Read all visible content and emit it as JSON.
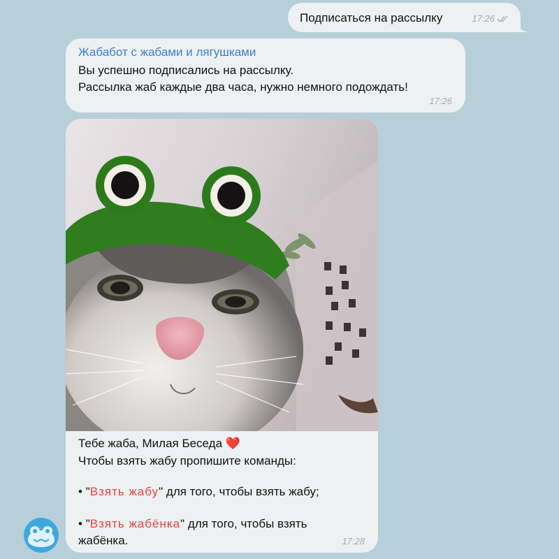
{
  "outgoing": {
    "text": "Подписаться на рассылку",
    "time": "17:26",
    "status_icon": "double-check-icon"
  },
  "message1": {
    "sender": "Жабабот с жабами и лягушками",
    "lines": [
      "Вы успешно подписались на рассылку.",
      "Рассылка жаб каждые два часа, нужно немного подождать!"
    ],
    "time": "17:26"
  },
  "message2": {
    "photo_icon": "cat-in-frog-hat-photo",
    "greeting": "Тебе жаба, Милая Беседа",
    "heart": "❤️",
    "instruction": "Чтобы взять жабу пропишите команды:",
    "bullet": "•",
    "quote": "\"",
    "cmd1": "Взять жабу",
    "cmd1_rest": " для того, чтобы взять жабу;",
    "cmd2": "Взять жабёнка",
    "cmd2_rest": " для того, чтобы взять",
    "cmd2_cont": "жабёнка.",
    "time": "17:28"
  },
  "avatar_icon": "frog-avatar-icon",
  "colors": {
    "background": "#b7cfd8",
    "bubble": "#eef1f2",
    "sender": "#3a7fd6",
    "command": "#e8423b"
  }
}
